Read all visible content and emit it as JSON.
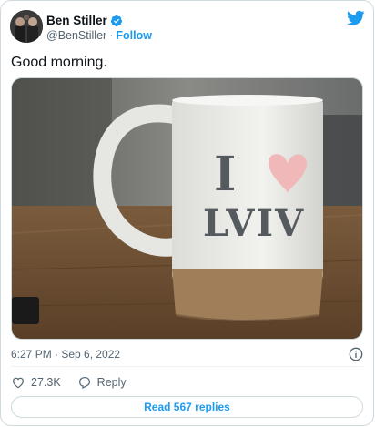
{
  "author": {
    "name": "Ben Stiller",
    "handle": "@BenStiller",
    "separator": "·",
    "follow_label": "Follow"
  },
  "tweet": {
    "text": "Good morning.",
    "timestamp": "6:27 PM · Sep 6, 2022"
  },
  "media": {
    "mug_line1": "I",
    "mug_line2": "LVIV"
  },
  "actions": {
    "like_count": "27.3K",
    "reply_label": "Reply"
  },
  "footer": {
    "read_replies_label": "Read 567 replies"
  },
  "colors": {
    "accent": "#1d9bf0",
    "heart": "#f0b8b8",
    "text": "#0f1419",
    "muted": "#536471"
  },
  "icons": [
    "verified-badge-icon",
    "twitter-bird-icon",
    "info-icon",
    "heart-icon",
    "reply-icon"
  ]
}
